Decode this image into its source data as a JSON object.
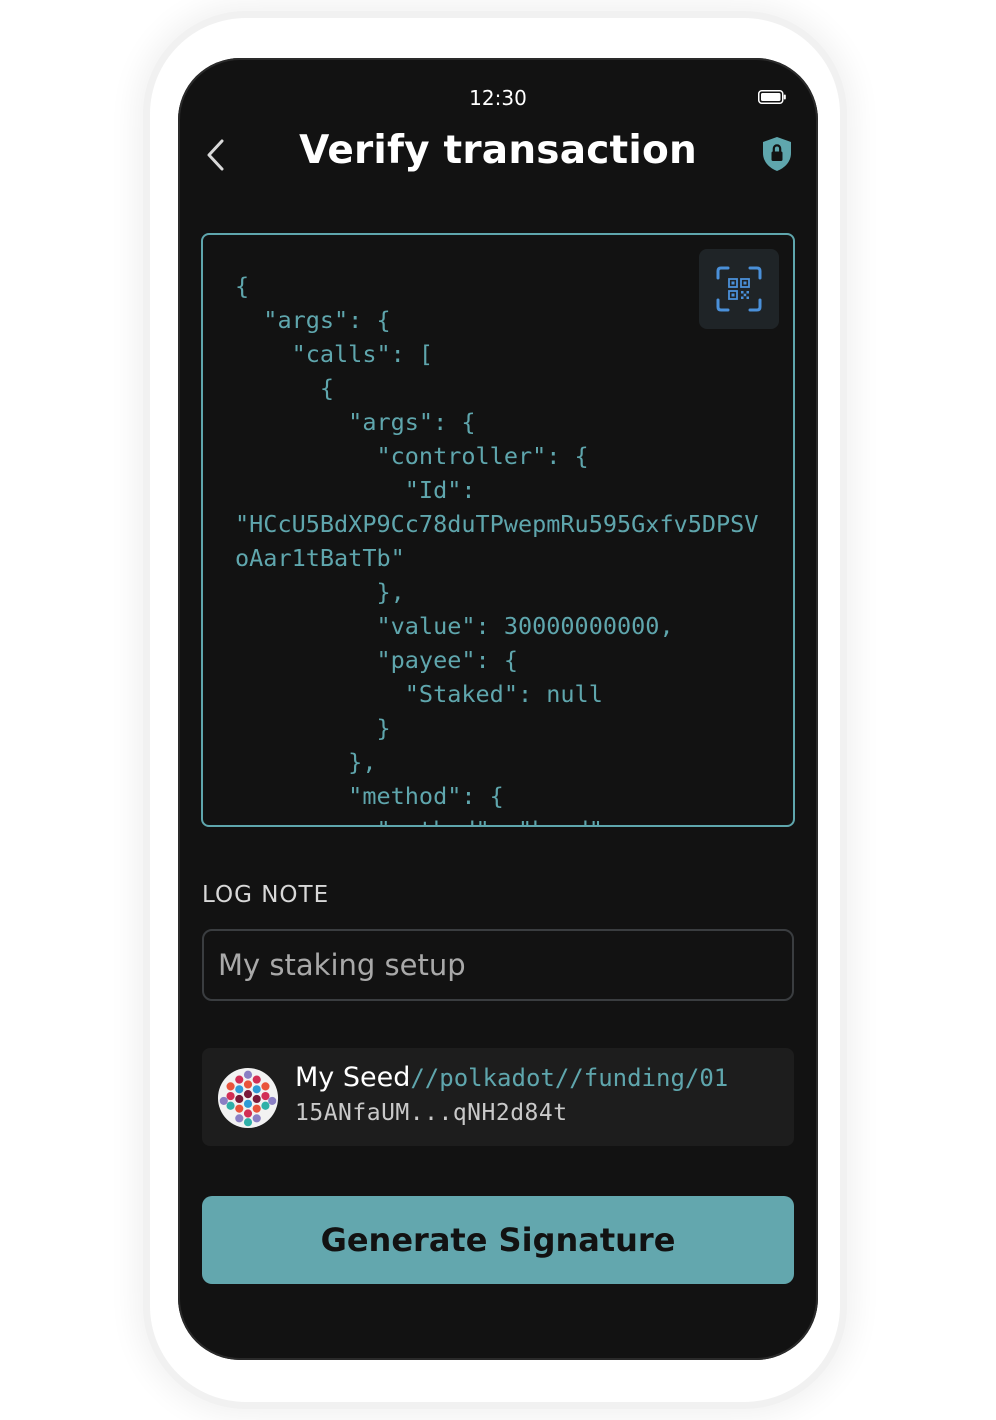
{
  "status_bar": {
    "time": "12:30",
    "battery_icon": "battery-icon"
  },
  "header": {
    "title": "Verify transaction",
    "back_icon": "chevron-left-icon",
    "security_icon": "shield-lock-icon"
  },
  "transaction": {
    "json_text": "{\n  \"args\": {\n    \"calls\": [\n      {\n        \"args\": {\n          \"controller\": {\n            \"Id\":\n\"HCcU5BdXP9Cc78duTPwepmRu595Gxfv5DPSV\noAar1tBatTb\"\n          },\n          \"value\": 30000000000,\n          \"payee\": {\n            \"Staked\": null\n          }\n        },\n        \"method\": {\n          \"method\": \"bond\"",
    "qr_icon": "qr-scan-icon"
  },
  "log_note": {
    "label": "LOG NOTE",
    "placeholder": "My staking setup",
    "value": ""
  },
  "account": {
    "name": "My Seed",
    "path": "//polkadot//funding/01",
    "address": "15ANfaUM...qNH2d84t",
    "avatar_icon": "identicon-avatar"
  },
  "actions": {
    "generate_label": "Generate Signature"
  },
  "colors": {
    "background": "#121212",
    "accent": "#5fa6ad",
    "button": "#63a7ae",
    "card": "#1d1d1d"
  }
}
